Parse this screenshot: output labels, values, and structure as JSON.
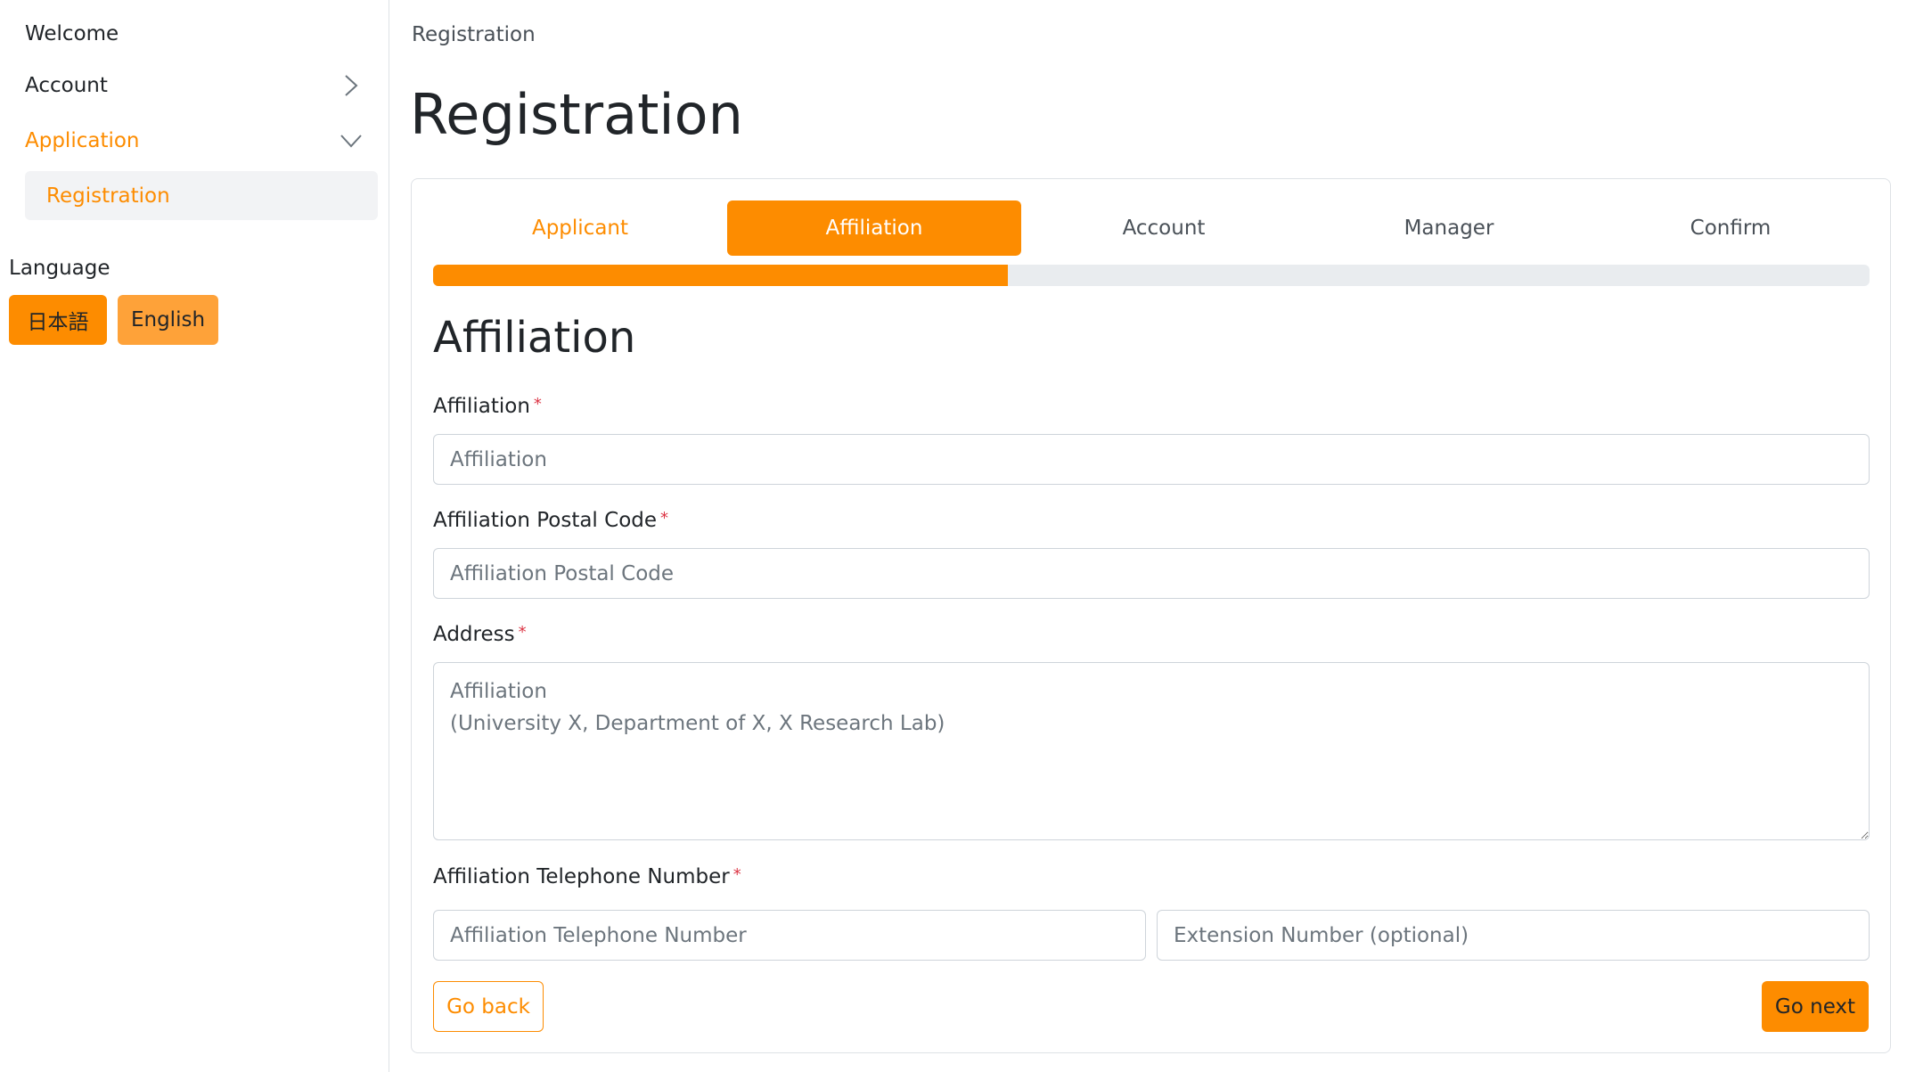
{
  "sidebar": {
    "items": [
      {
        "label": "Welcome"
      },
      {
        "label": "Account",
        "icon": "chevron-right-icon"
      },
      {
        "label": "Application",
        "icon": "chevron-down-icon"
      }
    ],
    "sub_item": "Registration",
    "language_label": "Language",
    "languages": [
      "日本語",
      "English"
    ]
  },
  "breadcrumb": "Registration",
  "page_title": "Registration",
  "steps": {
    "tabs": [
      "Applicant",
      "Affiliation",
      "Account",
      "Manager",
      "Confirm"
    ],
    "current_index": 1,
    "progress_fraction": 0.4
  },
  "form": {
    "section_title": "Affiliation",
    "required_marker": "*",
    "affiliation": {
      "label": "Affiliation",
      "placeholder": "Affiliation"
    },
    "postal": {
      "label": "Affiliation Postal Code",
      "placeholder": "Affiliation Postal Code"
    },
    "address": {
      "label": "Address",
      "placeholder": "Affiliation\n(University X, Department of X, X Research Lab)"
    },
    "telephone": {
      "label": "Affiliation Telephone Number",
      "placeholder": "Affiliation Telephone Number",
      "extension_placeholder": "Extension Number (optional)"
    },
    "back_label": "Go back",
    "next_label": "Go next"
  },
  "colors": {
    "accent": "#fd8c00",
    "accent_light": "#fea239",
    "required": "#dc3545"
  }
}
